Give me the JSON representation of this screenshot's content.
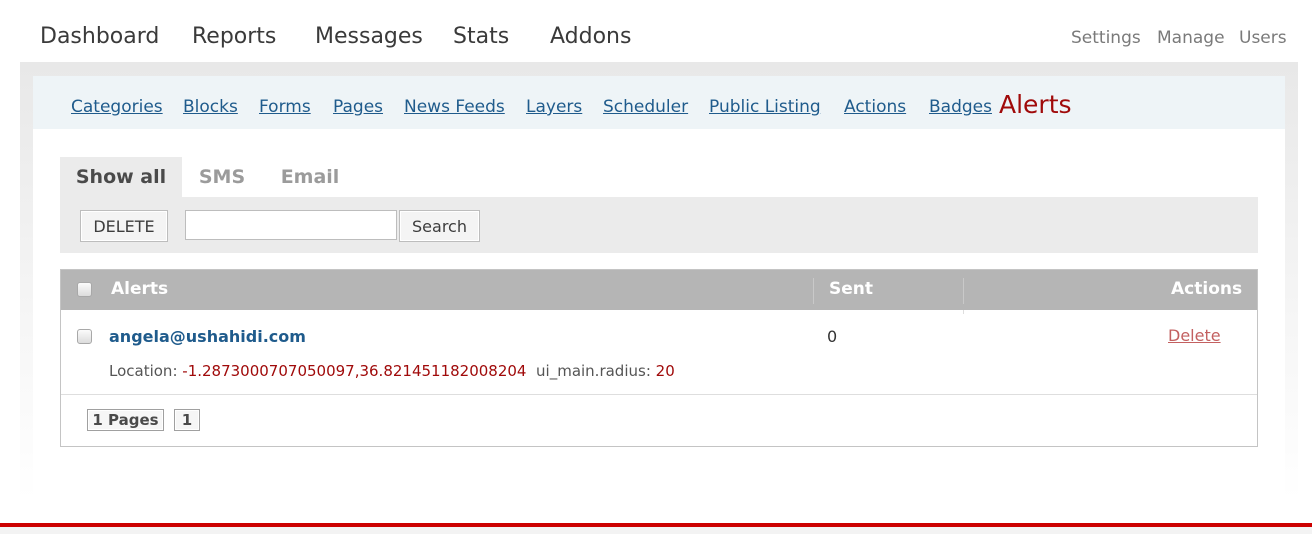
{
  "main_nav": {
    "items": [
      {
        "label": "Dashboard"
      },
      {
        "label": "Reports"
      },
      {
        "label": "Messages"
      },
      {
        "label": "Stats"
      },
      {
        "label": "Addons"
      }
    ]
  },
  "aux_nav": {
    "items": [
      {
        "label": "Settings"
      },
      {
        "label": "Manage"
      },
      {
        "label": "Users"
      }
    ]
  },
  "sub_nav": {
    "items": [
      {
        "label": "Categories"
      },
      {
        "label": "Blocks"
      },
      {
        "label": "Forms"
      },
      {
        "label": "Pages"
      },
      {
        "label": "News Feeds"
      },
      {
        "label": "Layers"
      },
      {
        "label": "Scheduler"
      },
      {
        "label": "Public Listing"
      },
      {
        "label": "Actions"
      },
      {
        "label": "Badges"
      }
    ],
    "current": "Alerts"
  },
  "tabs": [
    {
      "label": "Show all",
      "active": true
    },
    {
      "label": "SMS",
      "active": false
    },
    {
      "label": "Email",
      "active": false
    }
  ],
  "toolbar": {
    "delete_label": "DELETE",
    "search_value": "",
    "search_button": "Search"
  },
  "table": {
    "headers": {
      "alerts": "Alerts",
      "sent": "Sent",
      "actions": "Actions"
    },
    "rows": [
      {
        "recipient": "angela@ushahidi.com",
        "location_label": "Location:",
        "location_value": "-1.2873000707050097,36.821451182008204",
        "radius_label": "ui_main.radius:",
        "radius_value": "20",
        "sent": "0",
        "action": "Delete"
      }
    ],
    "pager": {
      "total_label": "1 Pages",
      "current": "1"
    }
  },
  "colors": {
    "link": "#1f5b8c",
    "current_section": "#a00a0a",
    "header_bg": "#b5b5b5",
    "footer_line": "#cc0000"
  }
}
